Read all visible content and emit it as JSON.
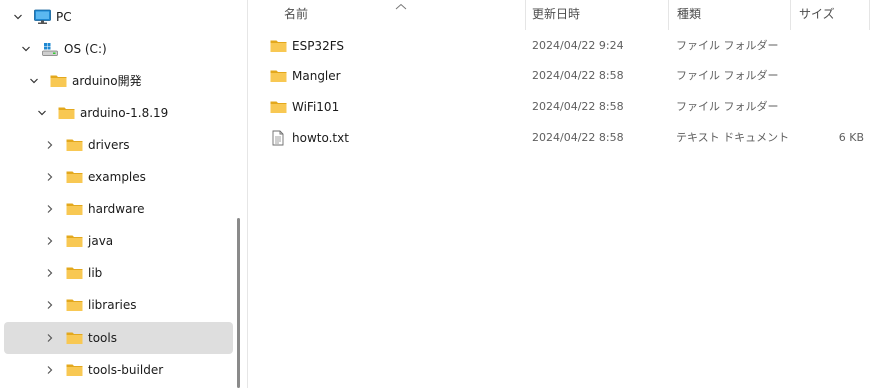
{
  "colors": {
    "folder": "#f8c853",
    "folder_dark": "#e3a81d",
    "selection": "#dedede",
    "monitor": "#1e88d2"
  },
  "nav": {
    "items": [
      {
        "label": "PC",
        "icon": "pc-icon",
        "expanded": true
      },
      {
        "label": "OS (C:)",
        "icon": "drive-icon",
        "expanded": true
      },
      {
        "label": "arduino開発",
        "icon": "folder-icon",
        "expanded": true
      },
      {
        "label": "arduino-1.8.19",
        "icon": "folder-icon",
        "expanded": true
      },
      {
        "label": "drivers",
        "icon": "folder-icon",
        "expanded": false
      },
      {
        "label": "examples",
        "icon": "folder-icon",
        "expanded": false
      },
      {
        "label": "hardware",
        "icon": "folder-icon",
        "expanded": false
      },
      {
        "label": "java",
        "icon": "folder-icon",
        "expanded": false
      },
      {
        "label": "lib",
        "icon": "folder-icon",
        "expanded": false
      },
      {
        "label": "libraries",
        "icon": "folder-icon",
        "expanded": false
      },
      {
        "label": "tools",
        "icon": "folder-icon",
        "expanded": false,
        "selected": true
      },
      {
        "label": "tools-builder",
        "icon": "folder-icon",
        "expanded": false
      }
    ]
  },
  "columns": {
    "name": "名前",
    "date": "更新日時",
    "type": "種類",
    "size": "サイズ"
  },
  "files": [
    {
      "name": "ESP32FS",
      "date": "2024/04/22 9:24",
      "type": "ファイル フォルダー",
      "size": "",
      "icon": "folder-icon"
    },
    {
      "name": "Mangler",
      "date": "2024/04/22 8:58",
      "type": "ファイル フォルダー",
      "size": "",
      "icon": "folder-icon"
    },
    {
      "name": "WiFi101",
      "date": "2024/04/22 8:58",
      "type": "ファイル フォルダー",
      "size": "",
      "icon": "folder-icon"
    },
    {
      "name": "howto.txt",
      "date": "2024/04/22 8:58",
      "type": "テキスト ドキュメント",
      "size": "6 KB",
      "icon": "text-file-icon"
    }
  ]
}
